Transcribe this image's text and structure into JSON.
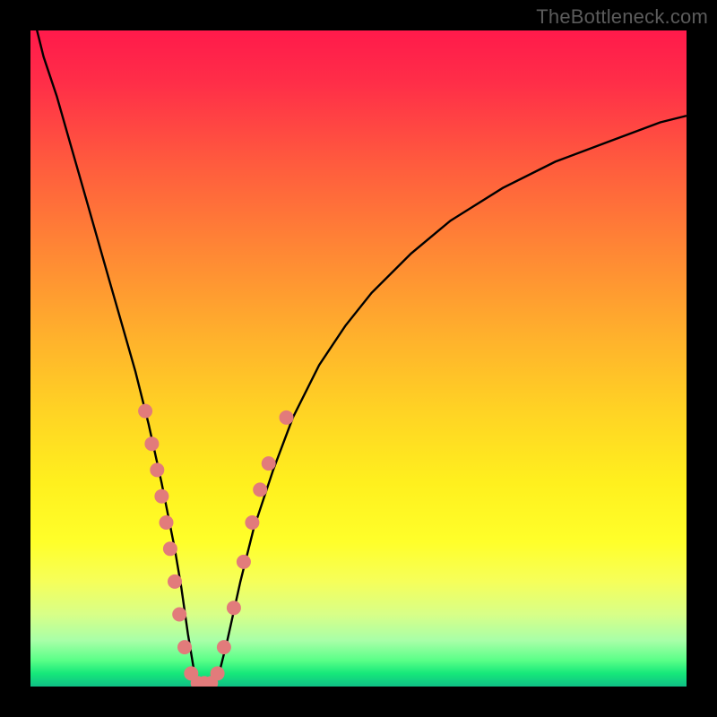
{
  "watermark": "TheBottleneck.com",
  "chart_data": {
    "type": "line",
    "title": "",
    "xlabel": "",
    "ylabel": "",
    "xlim": [
      0,
      100
    ],
    "ylim": [
      0,
      100
    ],
    "background": {
      "gradient_stops": [
        {
          "pct": 0,
          "color": "#ff1a4b"
        },
        {
          "pct": 8,
          "color": "#ff2e48"
        },
        {
          "pct": 20,
          "color": "#ff5a3e"
        },
        {
          "pct": 33,
          "color": "#ff8535"
        },
        {
          "pct": 47,
          "color": "#ffb22c"
        },
        {
          "pct": 58,
          "color": "#ffd324"
        },
        {
          "pct": 69,
          "color": "#fff01e"
        },
        {
          "pct": 78,
          "color": "#ffff2a"
        },
        {
          "pct": 84,
          "color": "#f6ff5a"
        },
        {
          "pct": 89,
          "color": "#d8ff88"
        },
        {
          "pct": 93,
          "color": "#a8ffa8"
        },
        {
          "pct": 96,
          "color": "#5aff88"
        },
        {
          "pct": 98,
          "color": "#16e87a"
        },
        {
          "pct": 100,
          "color": "#0fbf85"
        }
      ]
    },
    "series": [
      {
        "name": "bottleneck-curve",
        "color": "#000000",
        "x": [
          0,
          2,
          4,
          6,
          8,
          10,
          12,
          14,
          16,
          18,
          20,
          21,
          22,
          23,
          24,
          25,
          26,
          27,
          28,
          29,
          30,
          32,
          34,
          37,
          40,
          44,
          48,
          52,
          58,
          64,
          72,
          80,
          88,
          96,
          100
        ],
        "y": [
          104,
          96,
          90,
          83,
          76,
          69,
          62,
          55,
          48,
          40,
          31,
          26,
          21,
          15,
          8,
          2,
          0,
          0,
          1,
          3,
          7,
          16,
          24,
          33,
          41,
          49,
          55,
          60,
          66,
          71,
          76,
          80,
          83,
          86,
          87
        ]
      }
    ],
    "markers": [
      {
        "x": 17.5,
        "y": 42
      },
      {
        "x": 18.5,
        "y": 37
      },
      {
        "x": 19.3,
        "y": 33
      },
      {
        "x": 20.0,
        "y": 29
      },
      {
        "x": 20.7,
        "y": 25
      },
      {
        "x": 21.3,
        "y": 21
      },
      {
        "x": 22.0,
        "y": 16
      },
      {
        "x": 22.7,
        "y": 11
      },
      {
        "x": 23.5,
        "y": 6
      },
      {
        "x": 24.5,
        "y": 2
      },
      {
        "x": 25.5,
        "y": 0.5
      },
      {
        "x": 26.5,
        "y": 0.5
      },
      {
        "x": 27.5,
        "y": 0.5
      },
      {
        "x": 28.5,
        "y": 2
      },
      {
        "x": 29.5,
        "y": 6
      },
      {
        "x": 31.0,
        "y": 12
      },
      {
        "x": 32.5,
        "y": 19
      },
      {
        "x": 33.8,
        "y": 25
      },
      {
        "x": 35.0,
        "y": 30
      },
      {
        "x": 36.3,
        "y": 34
      },
      {
        "x": 39.0,
        "y": 41
      }
    ],
    "marker_style": {
      "color": "#e27b7b",
      "radius_px": 8
    }
  }
}
